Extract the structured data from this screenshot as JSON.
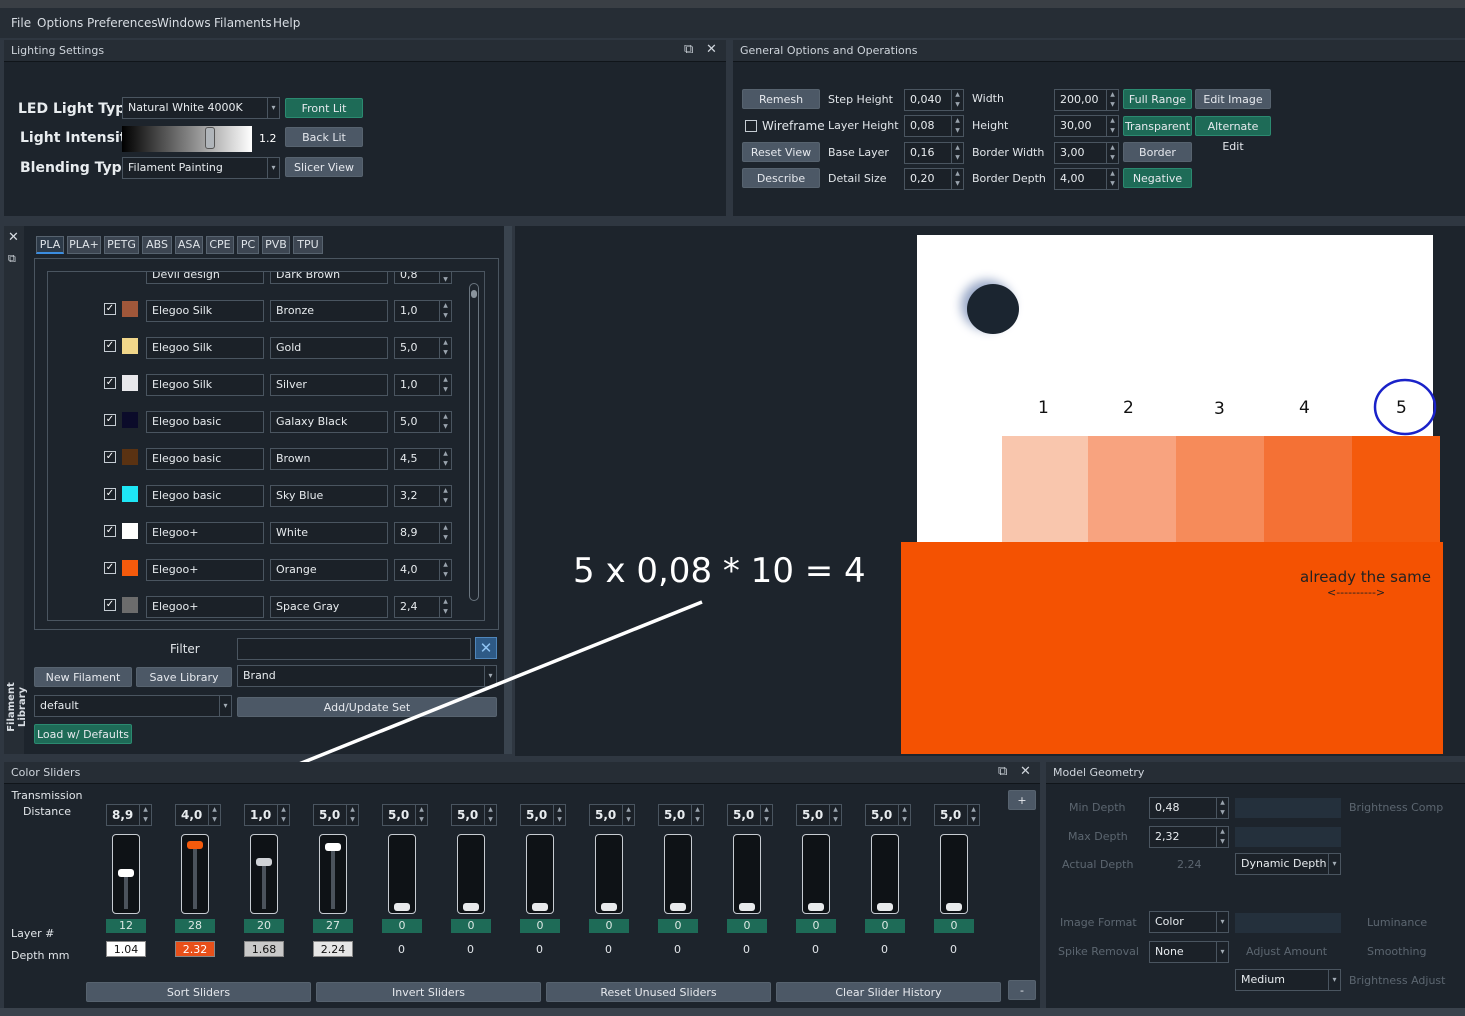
{
  "menu": [
    "File",
    "Options",
    "Preferences",
    "Windows",
    "Filaments",
    "Help"
  ],
  "lighting": {
    "title": "Lighting Settings",
    "led_label": "LED Light Type",
    "led_value": "Natural White 4000K",
    "intensity_label": "Light Intensity",
    "intensity_value": "1.2",
    "blending_label": "Blending Type",
    "blending_value": "Filament Painting",
    "front_lit": "Front Lit",
    "back_lit": "Back Lit",
    "slicer_view": "Slicer View"
  },
  "general": {
    "title": "General Options and Operations",
    "remesh": "Remesh",
    "wireframe": "Wireframe",
    "reset_view": "Reset View",
    "describe": "Describe",
    "step_height_label": "Step Height",
    "step_height": "0,040",
    "layer_height_label": "Layer Height",
    "layer_height": "0,08",
    "base_layer_label": "Base Layer",
    "base_layer": "0,16",
    "detail_size_label": "Detail Size",
    "detail_size": "0,20",
    "width_label": "Width",
    "width": "200,00",
    "height_label": "Height",
    "height": "30,00",
    "border_width_label": "Border Width",
    "border_width": "3,00",
    "border_depth_label": "Border Depth",
    "border_depth": "4,00",
    "full_range": "Full Range",
    "transparent": "Transparent",
    "border": "Border",
    "negative": "Negative",
    "edit_image": "Edit Image",
    "alternate_edit": "Alternate Edit"
  },
  "library": {
    "side_title": "Filament Library",
    "tabs": [
      "PLA",
      "PLA+",
      "PETG",
      "ABS",
      "ASA",
      "CPE",
      "PC",
      "PVB",
      "TPU"
    ],
    "partial_row": {
      "brand": "Devil design",
      "name": "Dark Brown",
      "td": "0,8"
    },
    "rows": [
      {
        "brand": "Elegoo Silk",
        "name": "Bronze",
        "td": "1,0",
        "color": "#a0573a"
      },
      {
        "brand": "Elegoo Silk",
        "name": "Gold",
        "td": "5,0",
        "color": "#f0d68a"
      },
      {
        "brand": "Elegoo Silk",
        "name": "Silver",
        "td": "1,0",
        "color": "#e8e8ec"
      },
      {
        "brand": "Elegoo basic",
        "name": "Galaxy Black",
        "td": "5,0",
        "color": "#0b0b2a"
      },
      {
        "brand": "Elegoo basic",
        "name": "Brown",
        "td": "4,5",
        "color": "#5a3212"
      },
      {
        "brand": "Elegoo basic",
        "name": "Sky Blue",
        "td": "3,2",
        "color": "#1ee6f5"
      },
      {
        "brand": "Elegoo+",
        "name": "White",
        "td": "8,9",
        "color": "#ffffff"
      },
      {
        "brand": "Elegoo+",
        "name": "Orange",
        "td": "4,0",
        "color": "#f45a0c"
      },
      {
        "brand": "Elegoo+",
        "name": "Space Gray",
        "td": "2,4",
        "color": "#6c6c6c"
      }
    ],
    "filter_label": "Filter",
    "new_filament": "New Filament",
    "save_library": "Save Library",
    "brand_value": "Brand",
    "set_value": "default",
    "add_update": "Add/Update Set",
    "load_defaults": "Load w/ Defaults"
  },
  "annotations": {
    "equation": "5 x 0,08 * 10 = 4",
    "steps": [
      "1",
      "2",
      "3",
      "4",
      "5"
    ],
    "note": "already the same",
    "note_arrow": "<---------->"
  },
  "color_sliders": {
    "title": "Color Sliders",
    "transmission_label": "Transmission Distance",
    "layer_label": "Layer #",
    "depth_label": "Depth mm",
    "plus": "+",
    "minus": "-",
    "sliders": [
      {
        "td": "8,9",
        "layer": "12",
        "depth": "1.04",
        "level": 0.55,
        "knob": "#ffffff",
        "depth_bg": "#ffffff"
      },
      {
        "td": "4,0",
        "layer": "28",
        "depth": "2.32",
        "level": 1.0,
        "knob": "#f45a0c",
        "depth_bg": "#e8501a"
      },
      {
        "td": "1,0",
        "layer": "20",
        "depth": "1.68",
        "level": 0.72,
        "knob": "#cfd2d6",
        "depth_bg": "#c9c9c9"
      },
      {
        "td": "5,0",
        "layer": "27",
        "depth": "2.24",
        "level": 0.97,
        "knob": "#ffffff",
        "depth_bg": "#e6e6e6"
      },
      {
        "td": "5,0",
        "layer": "0",
        "depth": "0",
        "level": 0.0
      },
      {
        "td": "5,0",
        "layer": "0",
        "depth": "0",
        "level": 0.0
      },
      {
        "td": "5,0",
        "layer": "0",
        "depth": "0",
        "level": 0.0
      },
      {
        "td": "5,0",
        "layer": "0",
        "depth": "0",
        "level": 0.0
      },
      {
        "td": "5,0",
        "layer": "0",
        "depth": "0",
        "level": 0.0
      },
      {
        "td": "5,0",
        "layer": "0",
        "depth": "0",
        "level": 0.0
      },
      {
        "td": "5,0",
        "layer": "0",
        "depth": "0",
        "level": 0.0
      },
      {
        "td": "5,0",
        "layer": "0",
        "depth": "0",
        "level": 0.0
      },
      {
        "td": "5,0",
        "layer": "0",
        "depth": "0",
        "level": 0.0
      }
    ],
    "sort": "Sort Sliders",
    "invert": "Invert Sliders",
    "reset_unused": "Reset Unused Sliders",
    "clear_history": "Clear Slider History"
  },
  "geometry": {
    "title": "Model Geometry",
    "min_depth_label": "Min Depth",
    "min_depth": "0,48",
    "max_depth_label": "Max Depth",
    "max_depth": "2,32",
    "actual_depth_label": "Actual Depth",
    "actual_depth": "2.24",
    "dynamic_depth": "Dynamic Depth",
    "image_format_label": "Image Format",
    "image_format": "Color",
    "spike_removal_label": "Spike Removal",
    "spike_removal": "None",
    "adjust_amount_label": "Adjust Amount",
    "medium": "Medium",
    "brightness_comp_label": "Brightness Comp",
    "luminance_label": "Luminance",
    "smoothing_label": "Smoothing",
    "brightness_adjust_label": "Brightness Adjust"
  }
}
